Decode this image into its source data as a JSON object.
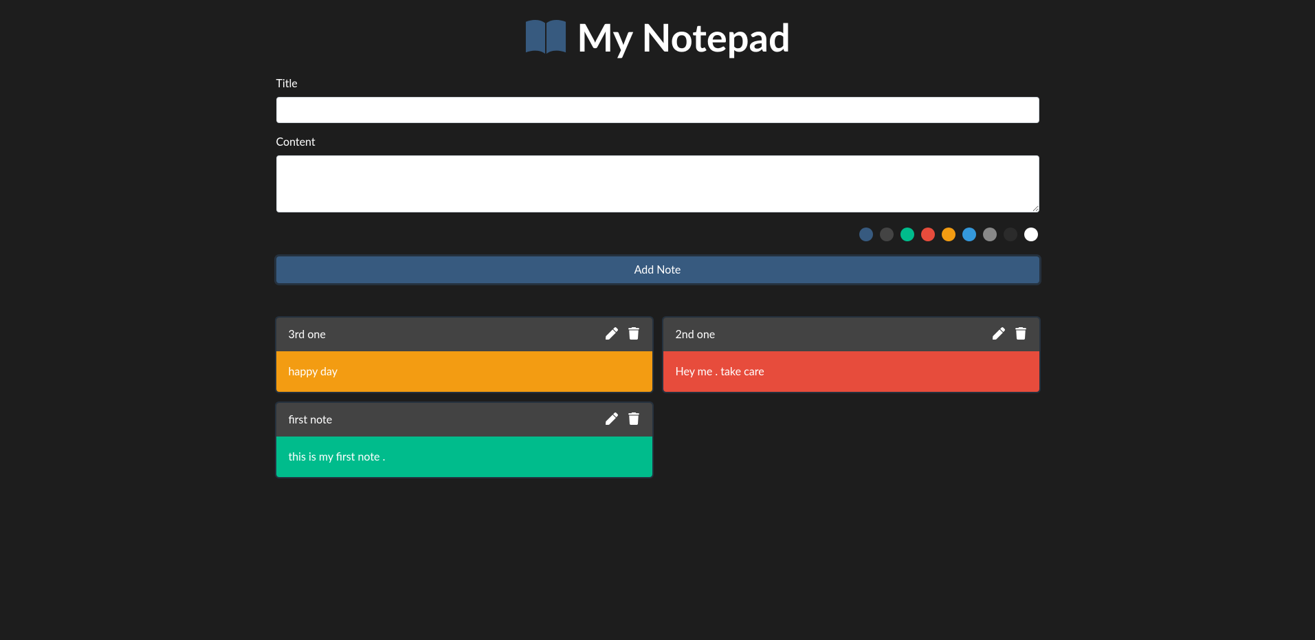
{
  "header": {
    "title": "My Notepad"
  },
  "form": {
    "title_label": "Title",
    "title_value": "",
    "content_label": "Content",
    "content_value": "",
    "add_button_label": "Add Note"
  },
  "colors": [
    {
      "name": "blue",
      "hex": "#375a7f"
    },
    {
      "name": "dark-gray",
      "hex": "#444444"
    },
    {
      "name": "green",
      "hex": "#00bc8c"
    },
    {
      "name": "red",
      "hex": "#e74c3c"
    },
    {
      "name": "orange",
      "hex": "#f39c12"
    },
    {
      "name": "sky",
      "hex": "#3498db"
    },
    {
      "name": "gray",
      "hex": "#888888"
    },
    {
      "name": "black",
      "hex": "#2b2b2b"
    },
    {
      "name": "white",
      "hex": "#ffffff"
    }
  ],
  "notes": [
    {
      "title": "3rd one",
      "content": "happy day",
      "color": "#f39c12"
    },
    {
      "title": "2nd one",
      "content": "Hey me . take care",
      "color": "#e74c3c"
    },
    {
      "title": "first note",
      "content": "this is my first note .",
      "color": "#00bc8c"
    }
  ],
  "icons": {
    "book": "book-icon",
    "edit": "pencil-icon",
    "delete": "trash-icon"
  }
}
